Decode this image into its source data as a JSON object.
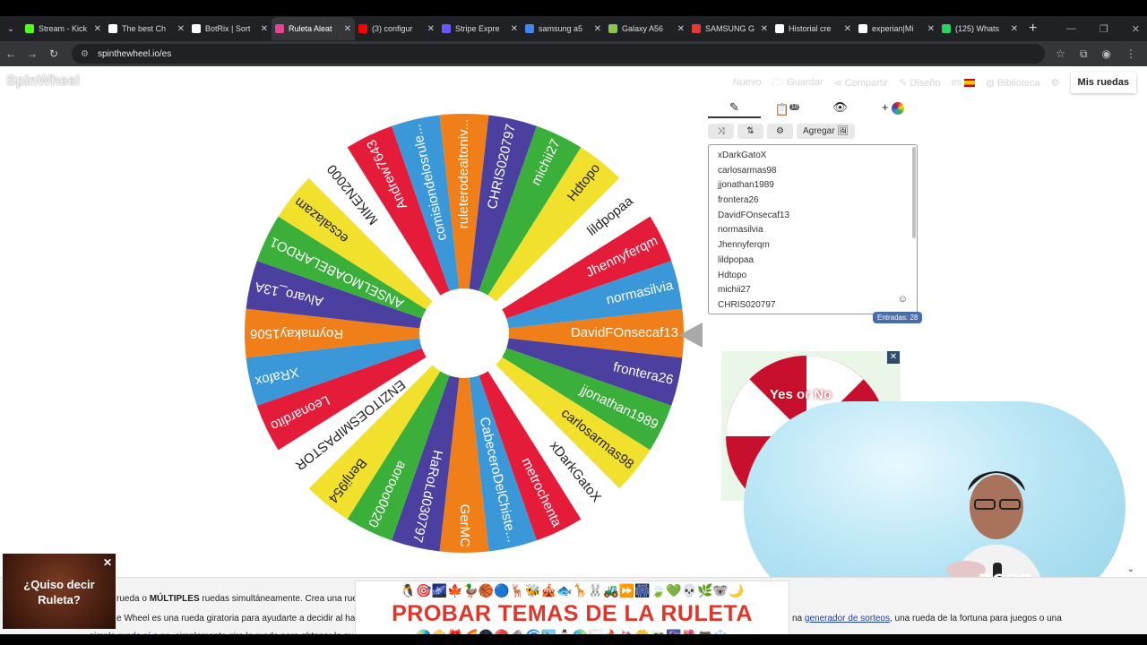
{
  "browser": {
    "tabs": [
      {
        "title": "Stream - Kick",
        "color": "#53fc18",
        "active": false
      },
      {
        "title": "The best Ch",
        "color": "#ffffff",
        "active": false
      },
      {
        "title": "BotRix | Sort",
        "color": "#ffffff",
        "active": false
      },
      {
        "title": "Ruleta Aleat",
        "color": "#e84393",
        "active": true
      },
      {
        "title": "(3) configur",
        "color": "#ff0000",
        "active": false
      },
      {
        "title": "Stripe Expre",
        "color": "#635bff",
        "active": false
      },
      {
        "title": "samsung a5",
        "color": "#4285f4",
        "active": false
      },
      {
        "title": "Galaxy A56",
        "color": "#8bc34a",
        "active": false
      },
      {
        "title": "SAMSUNG G",
        "color": "#e53935",
        "active": false
      },
      {
        "title": "Historial cre",
        "color": "#ffffff",
        "active": false
      },
      {
        "title": "experian|Mi",
        "color": "#ffffff",
        "active": false
      },
      {
        "title": "(125) Whats",
        "color": "#25d366",
        "active": false
      }
    ],
    "url": "spinthewheel.io/es"
  },
  "header": {
    "logo": "SpinWheel",
    "menu": [
      "Nuevo",
      "Guardar",
      "Compartir",
      "Diseño",
      "es"
    ],
    "biblioteca": "Biblioteca",
    "mis_ruedas": "Mis ruedas"
  },
  "wheel": {
    "colors": [
      "#f07f19",
      "#4b3fa0",
      "#3ab03a",
      "#f1e12d",
      "#ffffff",
      "#e51c39",
      "#3a98d8"
    ],
    "segments": [
      "DavidFOnsecaf13",
      "frontera26",
      "jjonathan1989",
      "carlosarmas98",
      "xDarkGatoX",
      "metrochenta",
      "CabeceroDelChiste...",
      "GerMC",
      "HaRoLd030797",
      "aorooo0020",
      "Benji954",
      "ENZITOESMIPASTOR",
      "Leonardito",
      "XRafox",
      "Roymakay1506",
      "Alvaro_13A",
      "ANSELMOABELARDO1",
      "ecsalazam",
      "MIKEN2000",
      "Andrew7643",
      "comisiondelosrule...",
      "ruleterodealtoniv...",
      "CHRIS020797",
      "michii27",
      "Hdtopo",
      "lildpopaa",
      "Jhennyferqm",
      "normasilvia"
    ]
  },
  "editor": {
    "tabs": [
      "edit-icon",
      "results-icon",
      "hide-icon",
      "add-color-icon"
    ],
    "results_badge": "10",
    "agregar": "Agregar",
    "entries": [
      "xDarkGatoX",
      "carlosarmas98",
      "jjonathan1989",
      "frontera26",
      "DavidFOnsecaf13",
      "normasilvia",
      "Jhennyferqm",
      "lildpopaa",
      "Hdtopo",
      "michii27",
      "CHRIS020797"
    ],
    "count": "Entradas: 28"
  },
  "ad": {
    "text": "Yes or No"
  },
  "footer": {
    "line1_a": "rueda o ",
    "line1_b": "MÚLTIPLES",
    "line1_c": " ruedas simultáneamente. Crea una rueda pe",
    "line2": "e Wheel es una rueda giratoria para ayudarte a decidir al hacer u",
    "line3_a": "simple ",
    "line3_link": "rueda sí o no",
    "line3_b": ", simplemente gira la rueda para obtener lo que nec",
    "line4_a": "na ",
    "line4_link": "generador de sorteos",
    "line4_b": ", una rueda de la fortuna para juegos o una"
  },
  "promo": {
    "emojis": "🐧🎯🌌🍁🦆🏀🔵🦌🐝🎪🐟🦒🐰🚜⏩🎆🍃💚💀🌿🐨🌙",
    "emojis2": "🌏🍿🎁🌈🌑🔴🪨🌀🏙️⛄🌍🌫️🔥🦄🌼🐲🌆🌺🎮❄️",
    "title": "PROBAR TEMAS DE LA RULETA"
  },
  "quiso": {
    "text": "¿Quiso decir Ruleta?"
  },
  "webcam": {
    "logo_text": "BOSS"
  }
}
